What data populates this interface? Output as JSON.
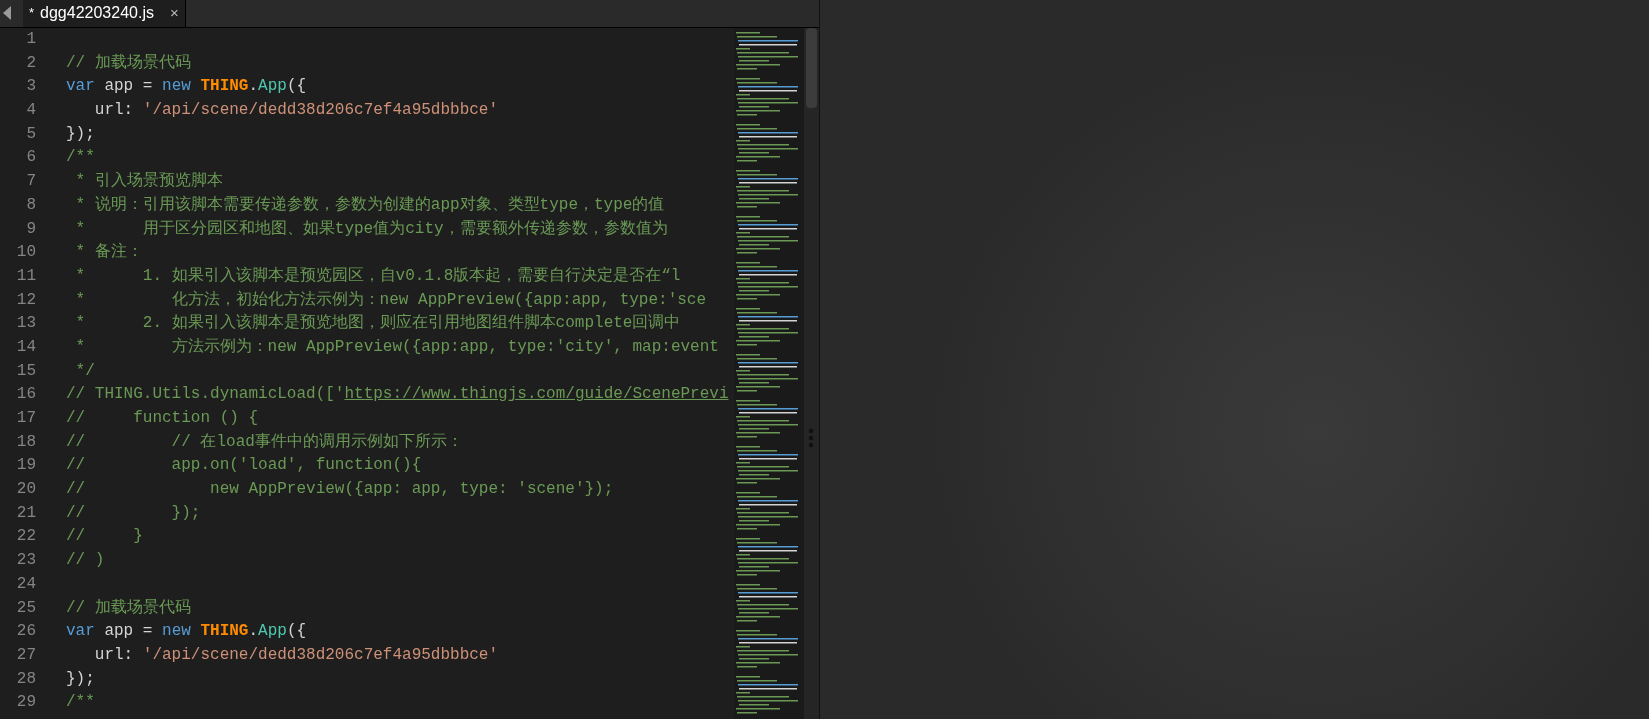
{
  "tabs": [
    {
      "modified_mark": "*",
      "label": "dgg42203240.js",
      "close": "×",
      "selected": true
    }
  ],
  "lines": [
    {
      "number": "1"
    },
    {
      "number": "2",
      "tokens": [
        {
          "kind": "comment",
          "text": "// 加载场景代码"
        }
      ]
    },
    {
      "number": "3",
      "tokens": [
        {
          "kind": "keyword",
          "text": "var"
        },
        {
          "kind": "plain",
          "text": " app = "
        },
        {
          "kind": "keyword",
          "text": "new"
        },
        {
          "kind": "object",
          "text": " THING"
        },
        {
          "kind": "plain",
          "text": "."
        },
        {
          "kind": "type",
          "text": "App"
        },
        {
          "kind": "plain",
          "text": "({"
        }
      ]
    },
    {
      "number": "4",
      "tokens": [
        {
          "kind": "plain",
          "text": "   url: "
        },
        {
          "kind": "string",
          "text": "'/api/scene/dedd38d206c7ef4a95dbbbce'"
        }
      ]
    },
    {
      "number": "5",
      "tokens": [
        {
          "kind": "plain",
          "text": "});"
        }
      ]
    },
    {
      "number": "6",
      "tokens": [
        {
          "kind": "comment",
          "text": "/**"
        }
      ]
    },
    {
      "number": "7",
      "tokens": [
        {
          "kind": "comment",
          "text": " * 引入场景预览脚本"
        }
      ]
    },
    {
      "number": "8",
      "tokens": [
        {
          "kind": "comment",
          "text": " * 说明：引用该脚本需要传递参数，参数为创建的app对象、类型type，type的值"
        }
      ]
    },
    {
      "number": "9",
      "tokens": [
        {
          "kind": "comment",
          "text": " *      用于区分园区和地图、如果type值为city，需要额外传递参数，参数值为"
        }
      ]
    },
    {
      "number": "10",
      "tokens": [
        {
          "kind": "comment",
          "text": " * 备注："
        }
      ]
    },
    {
      "number": "11",
      "tokens": [
        {
          "kind": "comment",
          "text": " *      1. 如果引入该脚本是预览园区，自v0.1.8版本起，需要自行决定是否在“l"
        }
      ]
    },
    {
      "number": "12",
      "tokens": [
        {
          "kind": "comment",
          "text": " *         化方法，初始化方法示例为：new AppPreview({app:app, type:'sce"
        }
      ]
    },
    {
      "number": "13",
      "tokens": [
        {
          "kind": "comment",
          "text": " *      2. 如果引入该脚本是预览地图，则应在引用地图组件脚本complete回调中"
        }
      ]
    },
    {
      "number": "14",
      "tokens": [
        {
          "kind": "comment",
          "text": " *         方法示例为：new AppPreview({app:app, type:'city', map:event"
        }
      ]
    },
    {
      "number": "15",
      "tokens": [
        {
          "kind": "comment",
          "text": " */"
        }
      ]
    },
    {
      "number": "16",
      "tokens": [
        {
          "kind": "comment",
          "text": "// THING.Utils.dynamicLoad(['"
        },
        {
          "kind": "link",
          "text": "https://www.thingjs.com/guide/ScenePrevi"
        }
      ]
    },
    {
      "number": "17",
      "tokens": [
        {
          "kind": "comment",
          "text": "//     function () {"
        }
      ]
    },
    {
      "number": "18",
      "tokens": [
        {
          "kind": "comment",
          "text": "//         // 在load事件中的调用示例如下所示："
        }
      ]
    },
    {
      "number": "19",
      "tokens": [
        {
          "kind": "comment",
          "text": "//         app.on('load', function(){"
        }
      ]
    },
    {
      "number": "20",
      "tokens": [
        {
          "kind": "comment",
          "text": "//             new AppPreview({app: app, type: 'scene'});"
        }
      ]
    },
    {
      "number": "21",
      "tokens": [
        {
          "kind": "comment",
          "text": "//         });"
        }
      ]
    },
    {
      "number": "22",
      "tokens": [
        {
          "kind": "comment",
          "text": "//     }"
        }
      ]
    },
    {
      "number": "23",
      "tokens": [
        {
          "kind": "comment",
          "text": "// )"
        }
      ]
    },
    {
      "number": "24"
    },
    {
      "number": "25",
      "tokens": [
        {
          "kind": "comment",
          "text": "// 加载场景代码"
        }
      ]
    },
    {
      "number": "26",
      "tokens": [
        {
          "kind": "keyword",
          "text": "var"
        },
        {
          "kind": "plain",
          "text": " app = "
        },
        {
          "kind": "keyword",
          "text": "new"
        },
        {
          "kind": "object",
          "text": " THING"
        },
        {
          "kind": "plain",
          "text": "."
        },
        {
          "kind": "type",
          "text": "App"
        },
        {
          "kind": "plain",
          "text": "({"
        }
      ]
    },
    {
      "number": "27",
      "tokens": [
        {
          "kind": "plain",
          "text": "   url: "
        },
        {
          "kind": "string",
          "text": "'/api/scene/dedd38d206c7ef4a95dbbbce'"
        }
      ]
    },
    {
      "number": "28",
      "tokens": [
        {
          "kind": "plain",
          "text": "});"
        }
      ]
    },
    {
      "number": "29",
      "tokens": [
        {
          "kind": "comment",
          "text": "/**"
        }
      ]
    }
  ]
}
